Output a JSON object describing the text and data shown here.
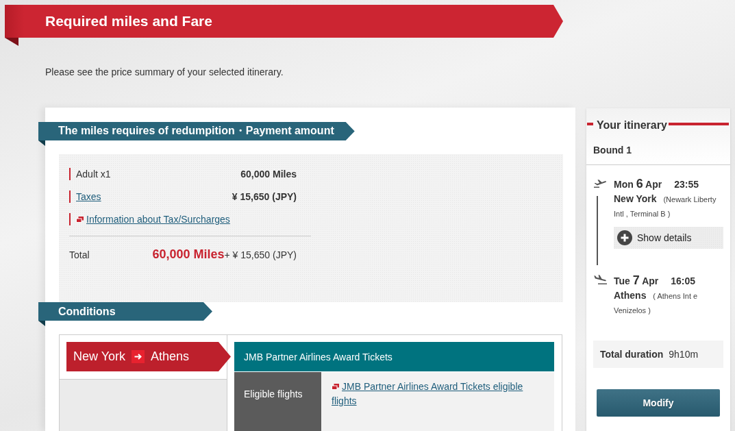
{
  "page": {
    "title": "Required miles and Fare",
    "intro": "Please see the price summary of your selected itinerary."
  },
  "payment": {
    "heading": "The miles requires of redumpition・Payment amount",
    "lines": [
      {
        "kind": "text",
        "label": "Adult x1",
        "value": "60,000 Miles"
      },
      {
        "kind": "link",
        "label": "Taxes",
        "value": "¥ 15,650 (JPY)"
      },
      {
        "kind": "info_link",
        "label": "Information about Tax/Surcharges"
      }
    ],
    "total": {
      "label": "Total",
      "miles": "60,000 Miles",
      "fare": "+ ¥ 15,650 (JPY)"
    }
  },
  "conditions": {
    "heading": "Conditions",
    "route": {
      "origin": "New York",
      "destination": "Athens"
    },
    "award_type": "JMB Partner Airlines Award Tickets",
    "rows": [
      {
        "label": "Eligible flights",
        "link": "JMB Partner Airlines Award Tickets eligible flights"
      }
    ]
  },
  "itinerary": {
    "heading": "Your itinerary",
    "bound": "Bound 1",
    "timeline": [
      {
        "kind": "departure",
        "weekday": "Mon",
        "day": "6",
        "month": "Apr",
        "time": "23:55",
        "city": "New York",
        "airport": "(Newark Liberty Intl , Terminal B )"
      },
      {
        "kind": "details",
        "label": "Show details"
      },
      {
        "kind": "arrival",
        "weekday": "Tue",
        "day": "7",
        "month": "Apr",
        "time": "16:05",
        "city": "Athens",
        "airport": "( Athens Int e Venizelos )"
      }
    ],
    "duration": {
      "label": "Total duration",
      "value": "9h10m"
    },
    "modify_button": "Modify"
  }
}
